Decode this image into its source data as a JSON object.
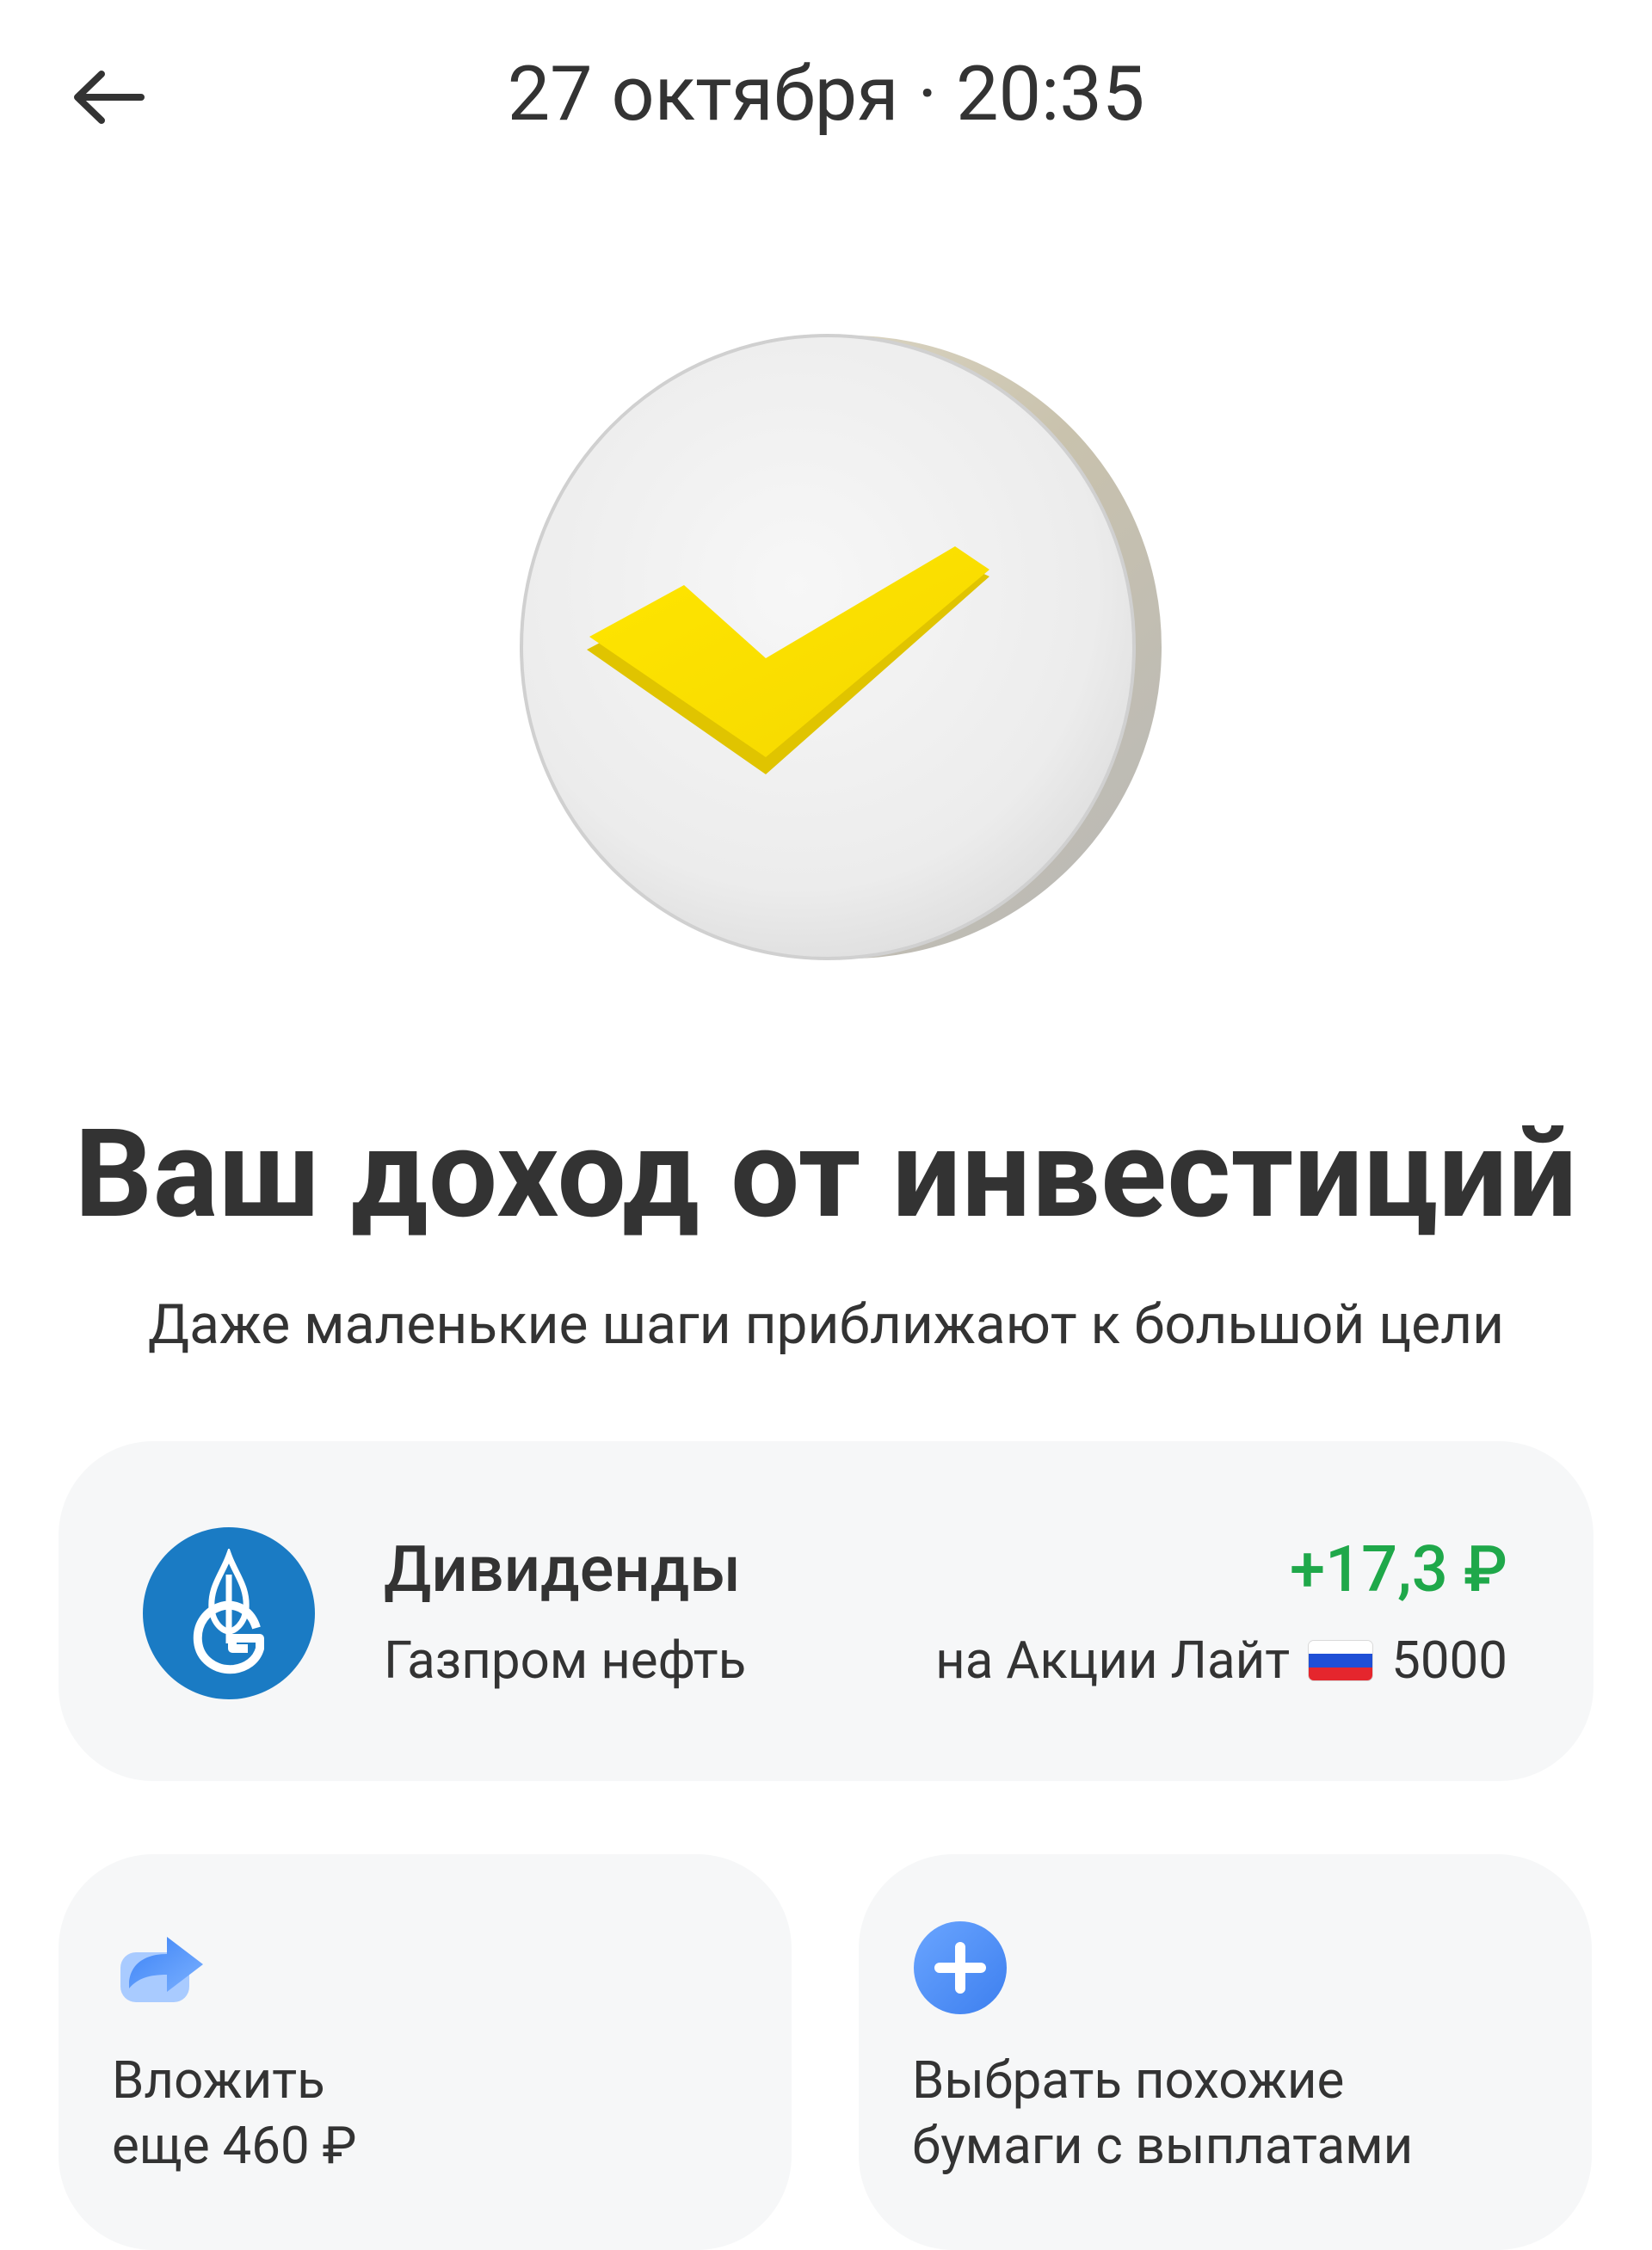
{
  "header": {
    "title": "27 октября · 20:35"
  },
  "hero": {
    "icon": "checkmark-coin",
    "accent_color": "#FFE000"
  },
  "main": {
    "title": "Ваш доход от инвестиций",
    "subtitle": "Даже маленькие шаги приближают к большой цели"
  },
  "dividend": {
    "title": "Дивиденды",
    "company": "Газпром нефть",
    "amount": "+17,3 ₽",
    "amount_color": "#1FA84A",
    "account_prefix": "на Акции Лайт",
    "account_flag": "russia-flag-icon",
    "account_number": "5000",
    "logo_icon": "gazprom-neft-logo",
    "logo_color": "#1A7BC4"
  },
  "actions": [
    {
      "icon": "share-forward-icon",
      "label": "Вложить\nеще 460 ₽"
    },
    {
      "icon": "plus-circle-icon",
      "label": "Выбрать похожие\nбумаги с выплатами"
    }
  ]
}
